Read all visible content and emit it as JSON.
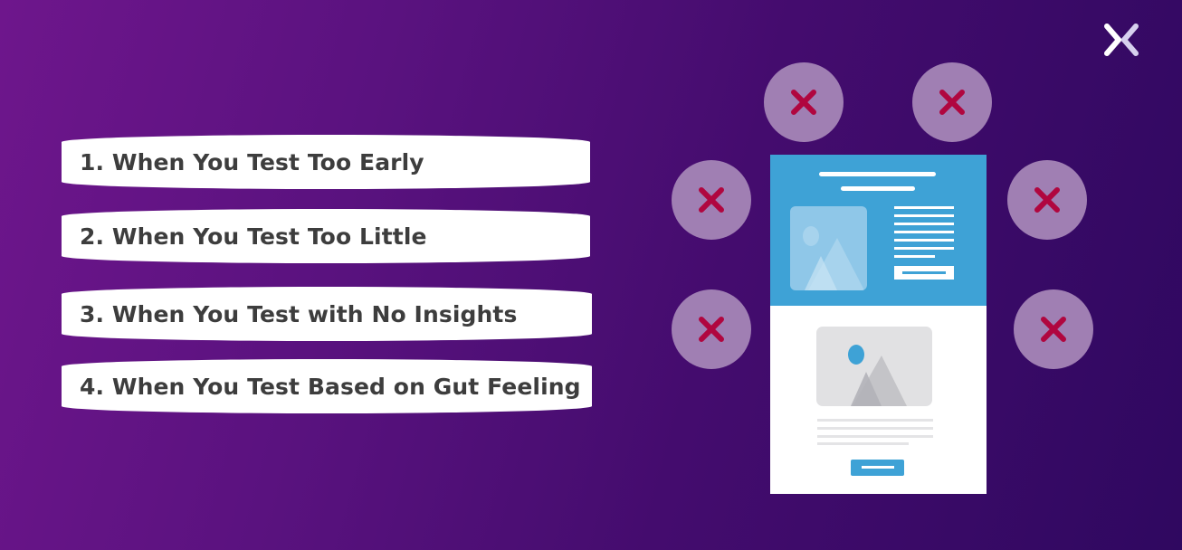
{
  "brand": {
    "logo_icon": "x-logo-icon",
    "colors": {
      "background_start": "#6e168c",
      "background_end": "#2f0860",
      "card_bg": "#ffffff",
      "card_text": "#3d3d3d",
      "circle_bg": "#a07fb3",
      "cross_color": "#b0063f",
      "mockup_accent": "#3ea2d6"
    }
  },
  "list": {
    "items": [
      {
        "label": "1. When You Test Too Early"
      },
      {
        "label": "2. When You Test Too Little"
      },
      {
        "label": "3. When You Test with No Insights"
      },
      {
        "label": "4. When You Test Based on Gut Feeling"
      }
    ]
  },
  "illustration": {
    "cross_icons": [
      "cross-icon",
      "cross-icon",
      "cross-icon",
      "cross-icon",
      "cross-icon",
      "cross-icon"
    ],
    "mockup": "email-template-wireframe"
  }
}
